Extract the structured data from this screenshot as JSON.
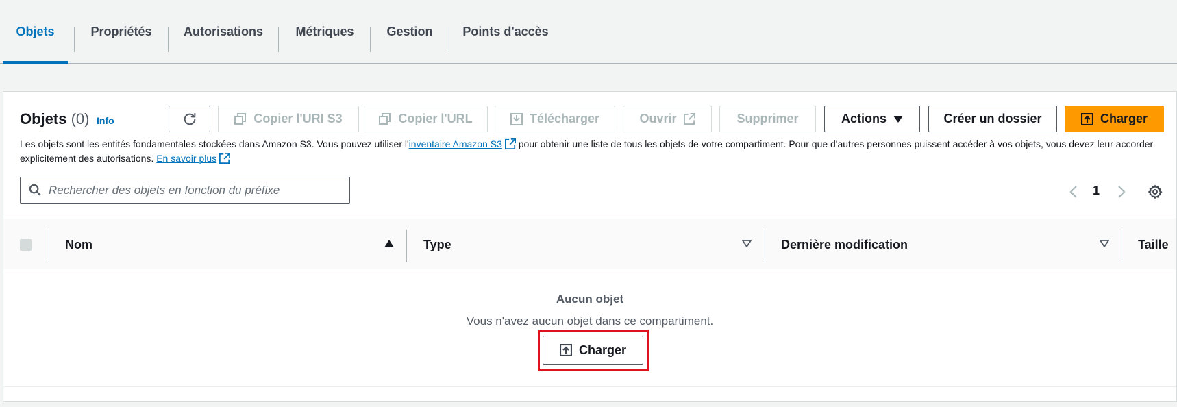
{
  "tabs": [
    {
      "label": "Objets",
      "active": true
    },
    {
      "label": "Propriétés"
    },
    {
      "label": "Autorisations"
    },
    {
      "label": "Métriques"
    },
    {
      "label": "Gestion"
    },
    {
      "label": "Points d'accès"
    }
  ],
  "header": {
    "title": "Objets",
    "count": "(0)",
    "info_label": "Info"
  },
  "toolbar": {
    "copy_uri_label": "Copier l'URI S3",
    "copy_url_label": "Copier l'URL",
    "download_label": "Télécharger",
    "open_label": "Ouvrir",
    "delete_label": "Supprimer",
    "actions_label": "Actions",
    "create_folder_label": "Créer un dossier",
    "upload_label": "Charger"
  },
  "description": {
    "part1": "Les objets sont les entités fondamentales stockées dans Amazon S3. Vous pouvez utiliser l'",
    "link1": "inventaire Amazon S3",
    "part2": " pour obtenir une liste de tous les objets de votre compartiment. Pour que d'autres personnes puissent accéder à vos objets, vous devez leur accorder explicitement des autorisations. ",
    "link2": "En savoir plus"
  },
  "search": {
    "placeholder": "Rechercher des objets en fonction du préfixe",
    "value": ""
  },
  "pagination": {
    "current_page": "1"
  },
  "table": {
    "columns": [
      "Nom",
      "Type",
      "Dernière modification",
      "Taille"
    ]
  },
  "empty_state": {
    "title": "Aucun objet",
    "message": "Vous n'avez aucun objet dans ce compartiment.",
    "button_label": "Charger"
  },
  "colors": {
    "accent": "#0073bb",
    "primary_button": "#ff9900",
    "highlight": "#e0121f"
  }
}
